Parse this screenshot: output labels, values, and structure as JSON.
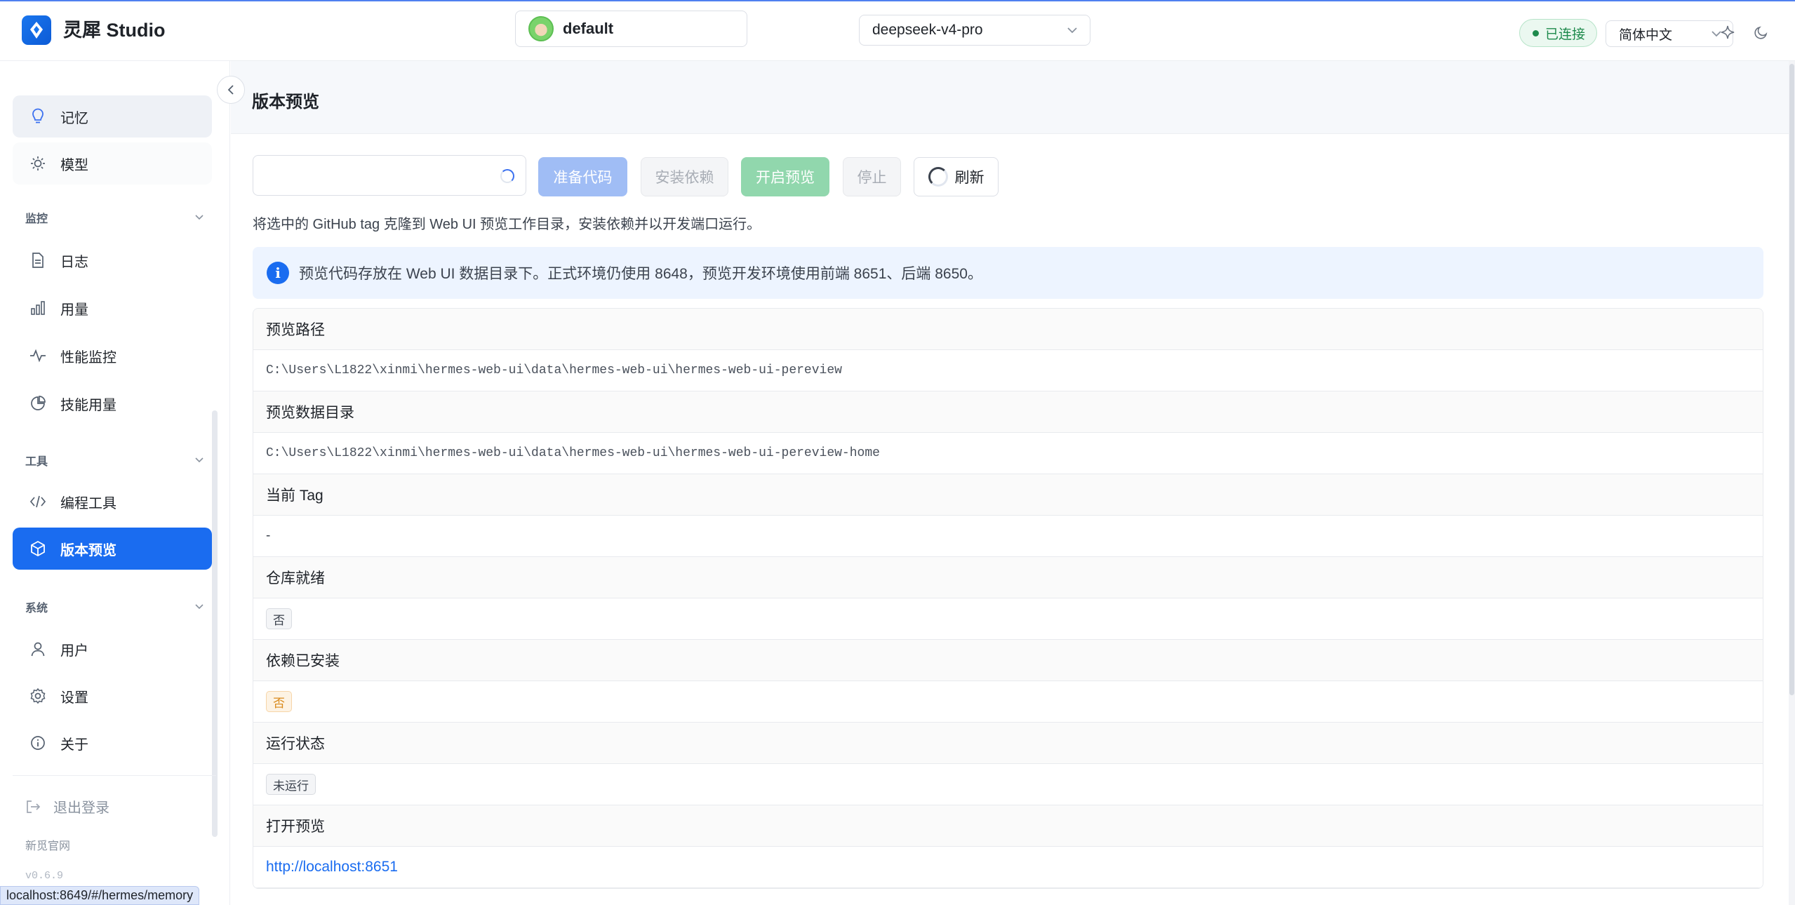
{
  "header": {
    "brand": "灵犀 Studio",
    "profile": "default",
    "model": "deepseek-v4-pro",
    "status": "已连接",
    "language": "简体中文"
  },
  "sidebar": {
    "top_items": [
      {
        "label": "记忆"
      },
      {
        "label": "模型"
      }
    ],
    "sections": {
      "monitor": "监控",
      "tools": "工具",
      "system": "系统"
    },
    "monitor_items": [
      {
        "label": "日志"
      },
      {
        "label": "用量"
      },
      {
        "label": "性能监控"
      },
      {
        "label": "技能用量"
      }
    ],
    "tools_items": [
      {
        "label": "编程工具"
      },
      {
        "label": "版本预览"
      }
    ],
    "system_items": [
      {
        "label": "用户"
      },
      {
        "label": "设置"
      },
      {
        "label": "关于"
      }
    ],
    "logout": "退出登录",
    "website": "新觅官网",
    "version": "v0.6.9",
    "url_tooltip": "localhost:8649/#/hermes/memory"
  },
  "main": {
    "title": "版本预览",
    "buttons": {
      "prepare": "准备代码",
      "install": "安装依赖",
      "start": "开启预览",
      "stop": "停止",
      "refresh": "刷新"
    },
    "description": "将选中的 GitHub tag 克隆到 Web UI 预览工作目录，安装依赖并以开发端口运行。",
    "alert": "预览代码存放在 Web UI 数据目录下。正式环境仍使用 8648，预览开发环境使用前端 8651、后端 8650。",
    "rows": {
      "preview_path_label": "预览路径",
      "preview_path": "C:\\Users\\L1822\\xinmi\\hermes-web-ui\\data\\hermes-web-ui\\hermes-web-ui-pereview",
      "data_dir_label": "预览数据目录",
      "data_dir": "C:\\Users\\L1822\\xinmi\\hermes-web-ui\\data\\hermes-web-ui\\hermes-web-ui-pereview-home",
      "current_tag_label": "当前 Tag",
      "current_tag": "-",
      "repo_ready_label": "仓库就绪",
      "repo_ready": "否",
      "deps_installed_label": "依赖已安装",
      "deps_installed": "否",
      "run_status_label": "运行状态",
      "run_status": "未运行",
      "open_preview_label": "打开预览",
      "open_preview": "http://localhost:8651"
    }
  }
}
